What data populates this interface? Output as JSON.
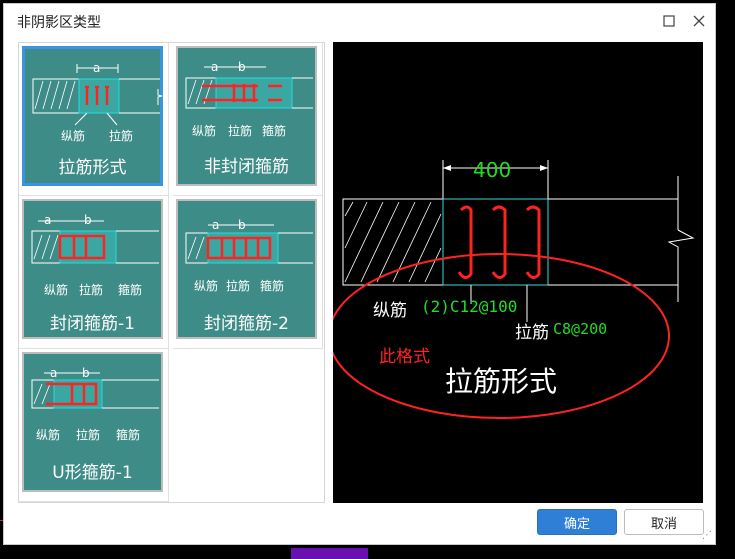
{
  "dialog": {
    "title": "非阴影区类型",
    "maximize_icon": "maximize-icon",
    "close_icon": "close-icon"
  },
  "types": [
    {
      "label": "拉筋形式",
      "selected": true,
      "dim_a": "a",
      "cap1": "纵筋",
      "cap2": "拉筋"
    },
    {
      "label": "非封闭箍筋",
      "selected": false,
      "dim_a": "a",
      "dim_b": "b",
      "cap1": "纵筋",
      "cap2": "拉筋",
      "cap3": "箍筋"
    },
    {
      "label": "封闭箍筋-1",
      "selected": false,
      "dim_a": "a",
      "dim_b": "b",
      "cap1": "纵筋",
      "cap2": "拉筋",
      "cap3": "箍筋"
    },
    {
      "label": "封闭箍筋-2",
      "selected": false,
      "dim_a": "a",
      "dim_b": "b",
      "cap1": "纵筋",
      "cap2": "拉筋",
      "cap3": "箍筋"
    },
    {
      "label": "U形箍筋-1",
      "selected": false,
      "dim_a": "a",
      "dim_b": "b",
      "cap1": "纵筋",
      "cap2": "拉筋",
      "cap3": "箍筋"
    }
  ],
  "preview": {
    "dimension": "400",
    "long_bar_label": "纵筋",
    "long_bar_spec": "(2)C12@100",
    "tie_label": "拉筋",
    "tie_spec": "C8@200",
    "annotation": "此格式",
    "type_name": "拉筋形式",
    "colors": {
      "green": "#22dd22",
      "red": "#ff2222",
      "cyan": "#33dddd"
    }
  },
  "buttons": {
    "ok": "确定",
    "cancel": "取消"
  }
}
